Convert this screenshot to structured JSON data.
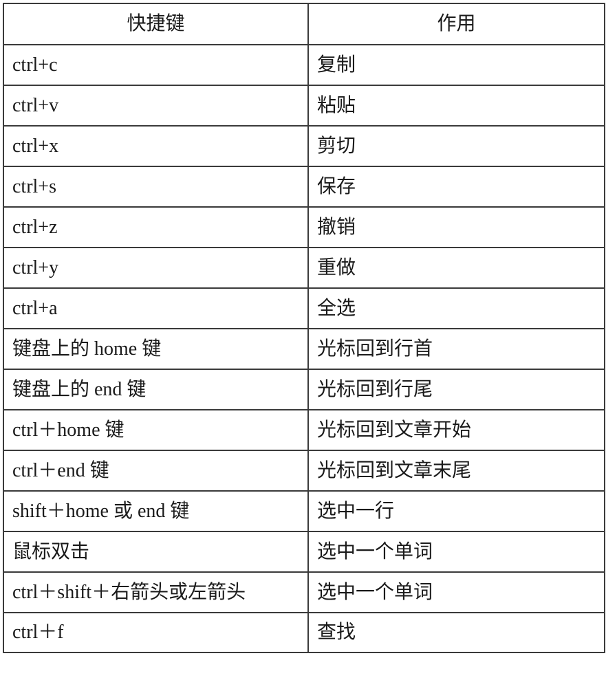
{
  "table": {
    "headers": [
      "快捷键",
      "作用"
    ],
    "rows": [
      {
        "key": "ctrl+c",
        "action": "复制"
      },
      {
        "key": "ctrl+v",
        "action": "粘贴"
      },
      {
        "key": "ctrl+x",
        "action": "剪切"
      },
      {
        "key": "ctrl+s",
        "action": "保存"
      },
      {
        "key": "ctrl+z",
        "action": "撤销"
      },
      {
        "key": "ctrl+y",
        "action": "重做"
      },
      {
        "key": "ctrl+a",
        "action": "全选"
      },
      {
        "key": "键盘上的 home 键",
        "action": "光标回到行首"
      },
      {
        "key": "键盘上的 end 键",
        "action": "光标回到行尾"
      },
      {
        "key": "ctrl＋home 键",
        "action": "光标回到文章开始"
      },
      {
        "key": "ctrl＋end 键",
        "action": "光标回到文章末尾"
      },
      {
        "key": "shift＋home  或  end 键",
        "action": "选中一行"
      },
      {
        "key": "鼠标双击",
        "action": "选中一个单词"
      },
      {
        "key": "ctrl＋shift＋右箭头或左箭头",
        "action": "选中一个单词"
      },
      {
        "key": "ctrl＋f",
        "action": "查找"
      }
    ]
  }
}
